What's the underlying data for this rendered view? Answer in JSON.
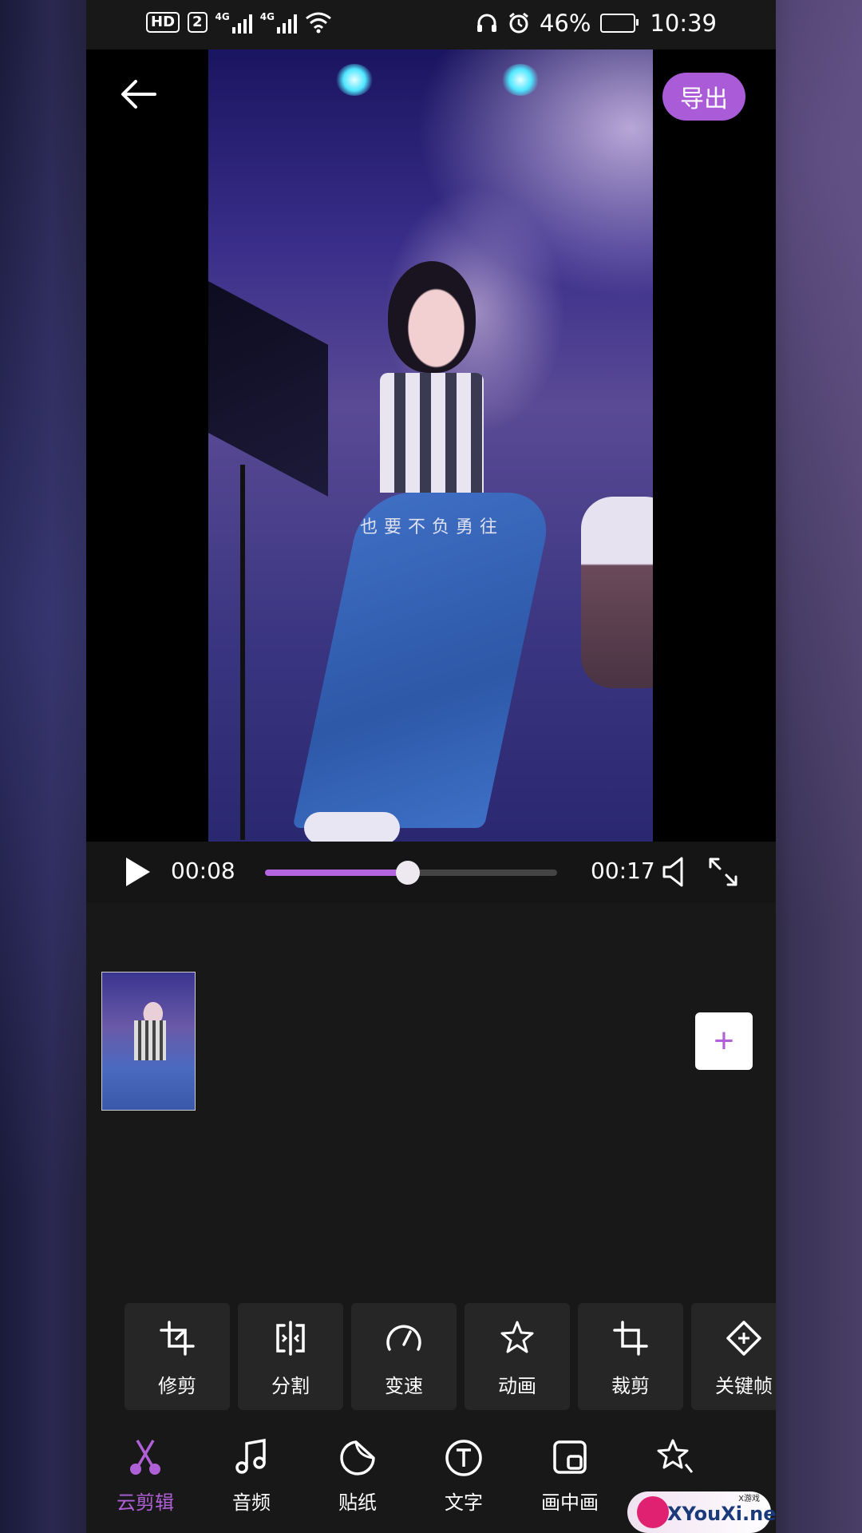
{
  "status_bar": {
    "hd": "HD",
    "sim": "2",
    "net1": "4G",
    "net2": "4G",
    "battery": "46%",
    "time": "10:39"
  },
  "player": {
    "export_label": "导出",
    "subtitle": "也要不负勇往",
    "current_time": "00:08",
    "total_time": "00:17",
    "progress": 0.49
  },
  "timeline": {
    "add_label": "+"
  },
  "tools": [
    {
      "label": "修剪",
      "icon": "trim-icon"
    },
    {
      "label": "分割",
      "icon": "split-icon"
    },
    {
      "label": "变速",
      "icon": "speed-icon"
    },
    {
      "label": "动画",
      "icon": "animation-icon"
    },
    {
      "label": "裁剪",
      "icon": "crop-icon"
    },
    {
      "label": "关键帧",
      "icon": "keyframe-icon"
    }
  ],
  "nav": [
    {
      "label": "云剪辑",
      "icon": "scissors-icon",
      "active": true
    },
    {
      "label": "音频",
      "icon": "music-icon"
    },
    {
      "label": "贴纸",
      "icon": "sticker-icon"
    },
    {
      "label": "文字",
      "icon": "text-icon"
    },
    {
      "label": "画中画",
      "icon": "pip-icon"
    },
    {
      "label": "特效",
      "icon": "effects-icon"
    }
  ],
  "watermark": {
    "text": "XYouXi.net",
    "small": "X游戏"
  },
  "colors": {
    "accent": "#a95bd8",
    "background": "#181818"
  }
}
